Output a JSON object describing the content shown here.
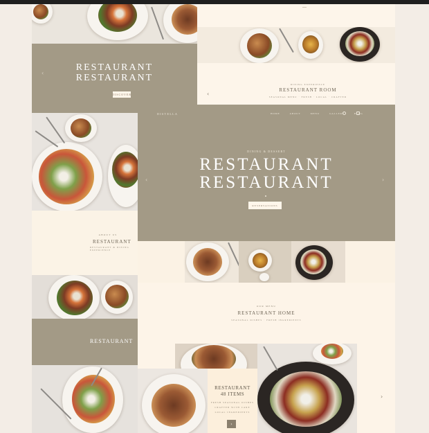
{
  "hero": {
    "logo": "DISTELLA",
    "nav": [
      "HOME",
      "ABOUT",
      "MENU",
      "GALLERY",
      "BLOG"
    ],
    "eyebrow": "DINING & DESSERT",
    "title_line1": "RESTAURANT",
    "title_line2": "RESTAURANT",
    "cta": "RESERVATIONS"
  },
  "left_card": {
    "title_line1": "RESTAURANT",
    "title_line2": "RESTAURANT",
    "cta": "DISCOVER"
  },
  "left_about": {
    "eyebrow": "ABOUT US",
    "title": "RESTAURANT",
    "subtitle": "RESTAURANT & DINING EXPERIENCE"
  },
  "left_band": {
    "title": "RESTAURANT"
  },
  "top_right": {
    "eyebrow": "DINING EXPERIENCE",
    "title": "RESTAURANT ROOM",
    "subtitle": "SEASONAL MENU · FRESH · LOCAL · CRAFTED"
  },
  "menu_section": {
    "eyebrow": "OUR MENU",
    "title": "RESTAURANT HOME",
    "subtitle": "SEASONAL DISHES · FRESH INGREDIENTS"
  },
  "feature_card": {
    "title_line1": "RESTAURANT",
    "title_line2": "48 ITEMS",
    "lines": [
      "FRESH SEASONAL DISHES",
      "CRAFTED WITH CARE",
      "LOCAL INGREDIENTS"
    ],
    "button_icon": "arrow-right-icon"
  },
  "icons": {
    "prev": "chevron-left-icon",
    "next": "chevron-right-icon",
    "search": "search-icon",
    "cart": "cart-icon"
  },
  "colors": {
    "taupe": "#a39a86",
    "cream": "#fbf3e6",
    "accent_button": "#8a7f6d"
  }
}
